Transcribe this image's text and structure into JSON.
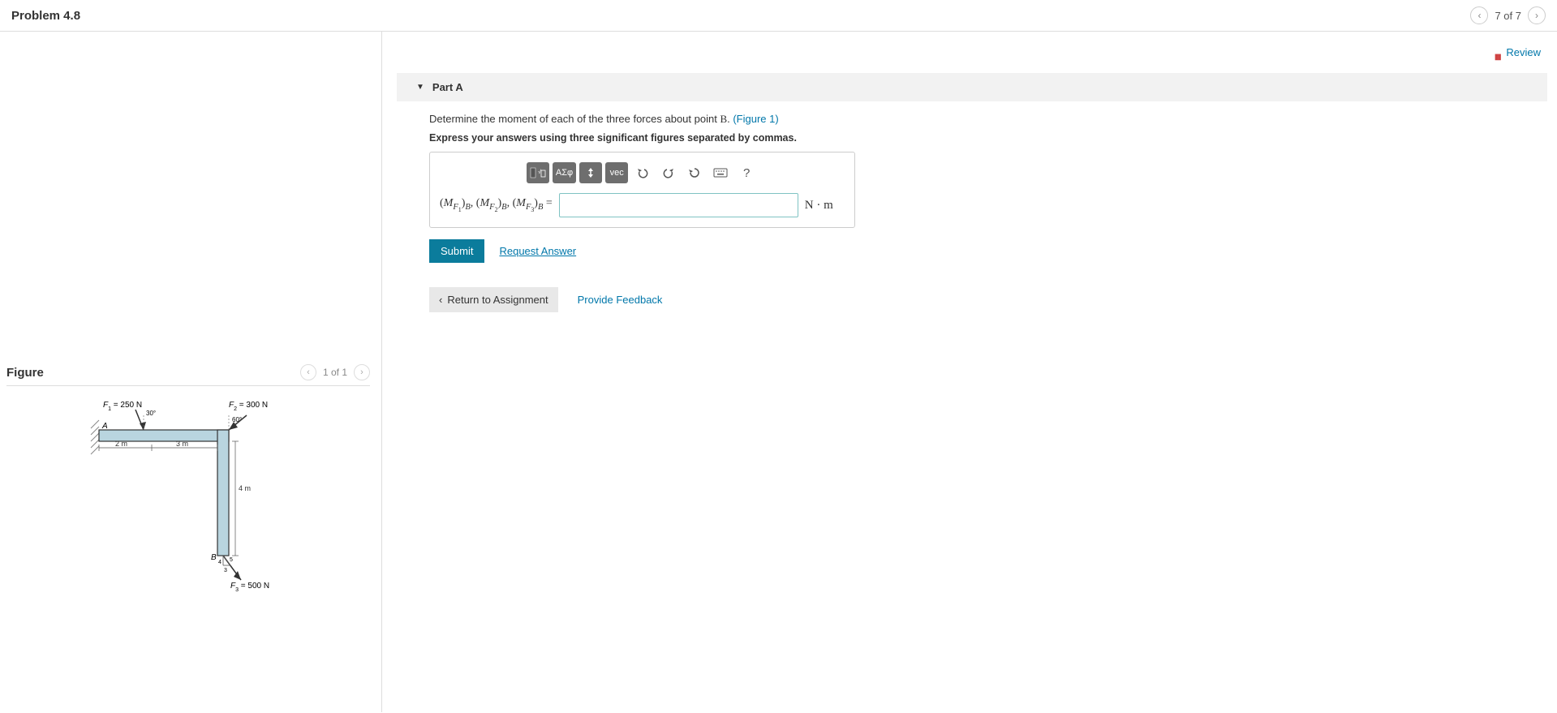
{
  "header": {
    "title": "Problem 4.8",
    "page_counter": "7 of 7"
  },
  "review": {
    "label": "Review"
  },
  "part": {
    "label": "Part A",
    "prompt_prefix": "Determine the moment of each of the three forces about point ",
    "prompt_point": "B",
    "prompt_suffix": ". ",
    "figure_link": "(Figure 1)",
    "express": "Express your answers using three significant figures separated by commas.",
    "equals": " =",
    "unit": "N · m",
    "input_value": ""
  },
  "toolbar": {
    "templates_title": "Templates",
    "symbols": "ΑΣφ",
    "subscript_title": "Sub/superscript",
    "vec": "vec",
    "undo_title": "Undo",
    "redo_title": "Redo",
    "reset_title": "Reset",
    "keyboard_title": "Keyboard",
    "help": "?"
  },
  "actions": {
    "submit": "Submit",
    "request": "Request Answer",
    "return": "Return to Assignment",
    "feedback": "Provide Feedback"
  },
  "figure": {
    "title": "Figure",
    "counter": "1 of 1",
    "F1_label": "F₁ = 250 N",
    "F1_angle": "30°",
    "F2_label": "F₂ = 300 N",
    "F2_angle": "60°",
    "F3_label": "F₃ = 500 N",
    "F3_tri_h": "3",
    "F3_tri_v": "4",
    "F3_tri_hyp": "5",
    "len1": "2 m",
    "len2": "3 m",
    "len3": "4 m",
    "pointA": "A",
    "pointB": "B"
  }
}
